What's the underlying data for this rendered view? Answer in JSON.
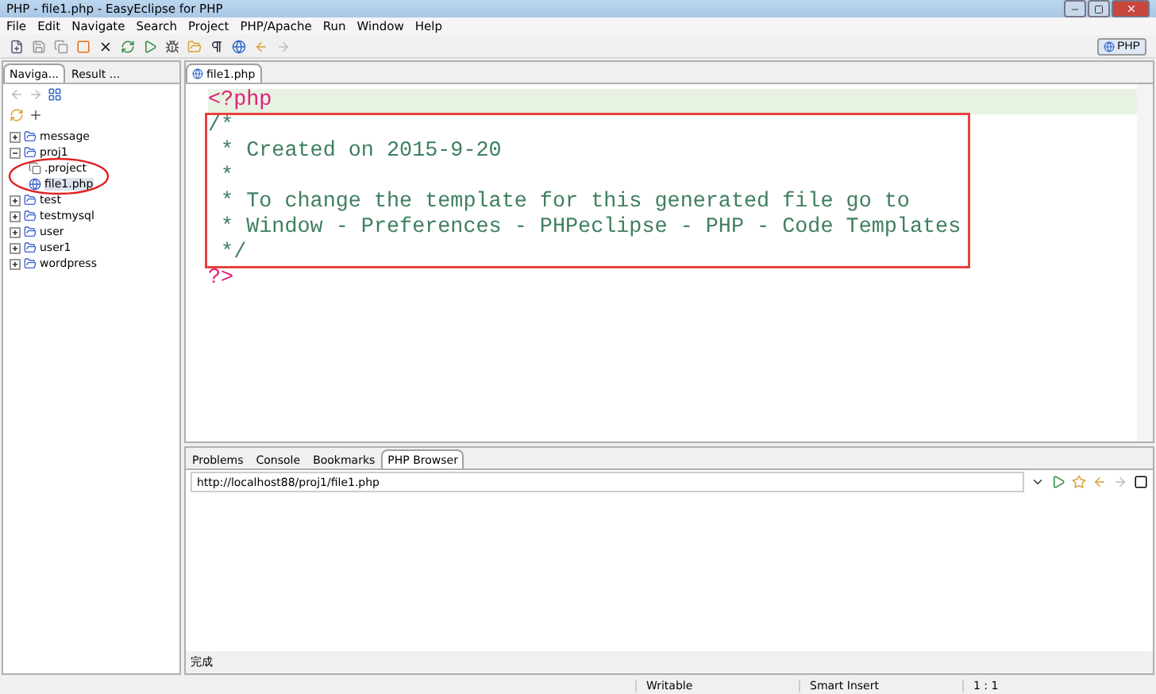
{
  "window": {
    "title": "PHP - file1.php - EasyEclipse for PHP"
  },
  "menu": [
    "File",
    "Edit",
    "Navigate",
    "Search",
    "Project",
    "PHP/Apache",
    "Run",
    "Window",
    "Help"
  ],
  "perspective": {
    "label": "PHP",
    "selected": true
  },
  "left_tabs": [
    {
      "label": "Naviga...",
      "selected": true
    },
    {
      "label": "Result ...",
      "selected": false
    }
  ],
  "tree": [
    {
      "label": "message",
      "kind": "project",
      "expanded": false
    },
    {
      "label": "proj1",
      "kind": "project",
      "expanded": true,
      "children": [
        {
          "label": ".project",
          "kind": "file",
          "selected": false
        },
        {
          "label": "file1.php",
          "kind": "php",
          "selected": true
        }
      ]
    },
    {
      "label": "test",
      "kind": "project",
      "expanded": false
    },
    {
      "label": "testmysql",
      "kind": "project",
      "expanded": false
    },
    {
      "label": "user",
      "kind": "project",
      "expanded": false
    },
    {
      "label": "user1",
      "kind": "project",
      "expanded": false
    },
    {
      "label": "wordpress",
      "kind": "project",
      "expanded": false
    }
  ],
  "editor": {
    "tab": "file1.php",
    "lines": [
      {
        "kind": "tag",
        "text": "<?php"
      },
      {
        "kind": "comment",
        "text": "/*"
      },
      {
        "kind": "comment",
        "text": " * Created on 2015-9-20"
      },
      {
        "kind": "comment",
        "text": " *"
      },
      {
        "kind": "comment",
        "text": " * To change the template for this generated file go to"
      },
      {
        "kind": "comment",
        "text": " * Window - Preferences - PHPeclipse - PHP - Code Templates"
      },
      {
        "kind": "comment",
        "text": " */"
      },
      {
        "kind": "tag",
        "text": "?>"
      }
    ]
  },
  "bottom_tabs": [
    {
      "label": "Problems",
      "selected": false
    },
    {
      "label": "Console",
      "selected": false
    },
    {
      "label": "Bookmarks",
      "selected": false
    },
    {
      "label": "PHP Browser",
      "selected": true
    }
  ],
  "browser": {
    "url": "http://localhost88/proj1/file1.php",
    "status": "完成"
  },
  "status_bar": [
    "Writable",
    "Smart Insert",
    "1 : 1"
  ]
}
